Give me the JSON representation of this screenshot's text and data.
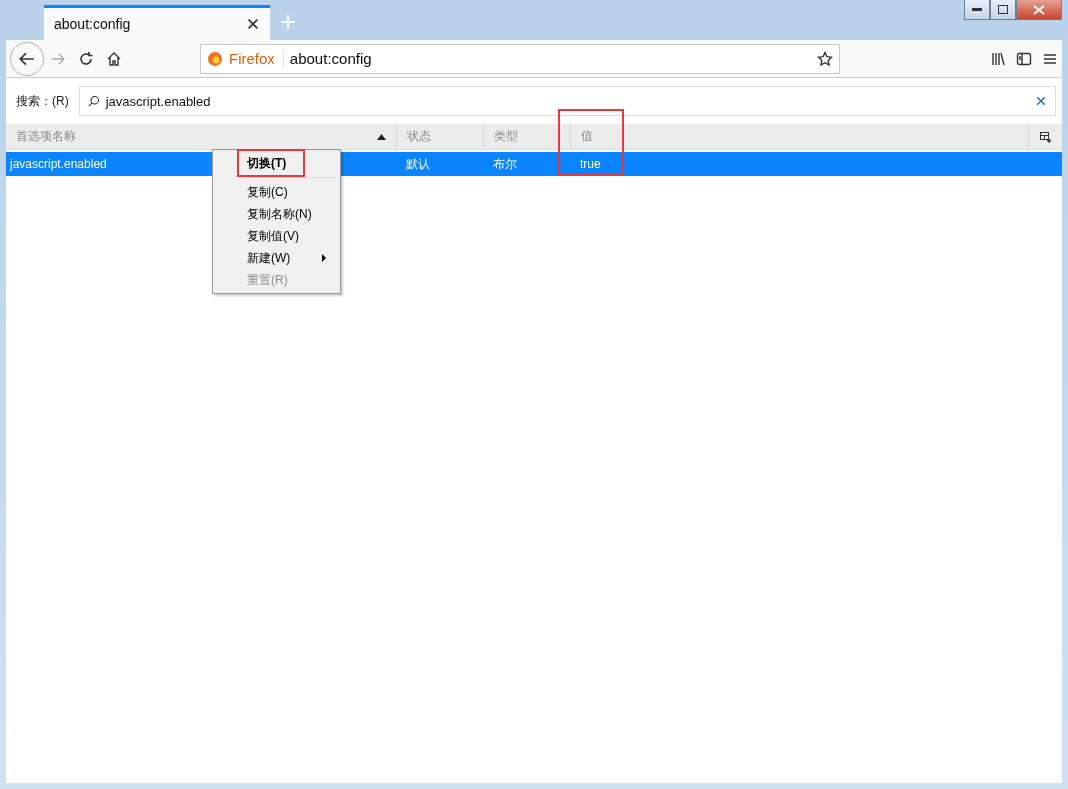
{
  "tab": {
    "title": "about:config"
  },
  "toolbar": {
    "identity": "Firefox",
    "url": "about:config"
  },
  "search": {
    "label": "搜索：(R)",
    "value": "javascript.enabled"
  },
  "columns": [
    {
      "label": "首选项名称",
      "sorted": true,
      "highlighted": false
    },
    {
      "label": "状态",
      "sorted": false,
      "highlighted": false
    },
    {
      "label": "类型",
      "sorted": false,
      "highlighted": false
    },
    {
      "label": "值",
      "sorted": false,
      "highlighted": true
    }
  ],
  "rows": [
    {
      "cells": [
        "javascript.enabled",
        "默认",
        "布尔",
        "true"
      ],
      "selected": true
    }
  ],
  "context_menu": [
    {
      "label": "切换(T)",
      "kind": "default",
      "disabled": false,
      "highlighted": true
    },
    {
      "kind": "separator"
    },
    {
      "label": "复制(C)",
      "kind": "item",
      "disabled": false,
      "highlighted": false
    },
    {
      "label": "复制名称(N)",
      "kind": "item",
      "disabled": false,
      "highlighted": false
    },
    {
      "label": "复制值(V)",
      "kind": "item",
      "disabled": false,
      "highlighted": false
    },
    {
      "label": "新建(W)",
      "kind": "submenu",
      "disabled": false,
      "highlighted": false
    },
    {
      "label": "重置(R)",
      "kind": "item",
      "disabled": true,
      "highlighted": false
    }
  ]
}
